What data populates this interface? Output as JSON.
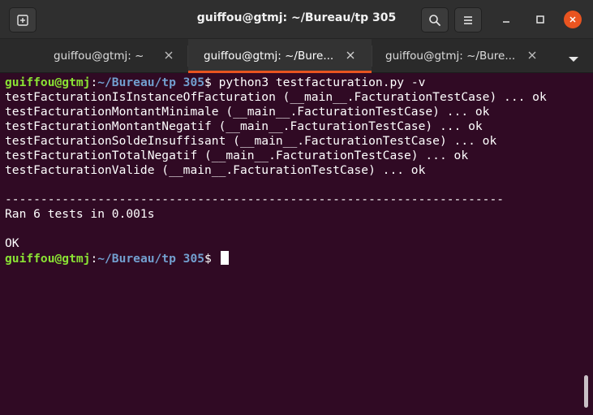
{
  "window": {
    "title": "guiffou@gtmj: ~/Bureau/tp 305"
  },
  "headerbar": {
    "new_tab_icon": "new-tab-icon",
    "search_icon": "search-icon",
    "menu_icon": "hamburger-menu-icon",
    "minimize_icon": "minimize-icon",
    "maximize_icon": "maximize-icon",
    "close_icon": "close-icon"
  },
  "tabs": [
    {
      "label": "guiffou@gtmj: ~",
      "active": false
    },
    {
      "label": "guiffou@gtmj: ~/Bure...",
      "active": true
    },
    {
      "label": "guiffou@gtmj: ~/Bure...",
      "active": false
    }
  ],
  "tab_overflow_icon": "dropdown-arrow-icon",
  "terminal": {
    "prompt_user": "guiffou@gtmj",
    "prompt_sep": ":",
    "prompt_path": "~/Bureau/tp 305",
    "prompt_symbol": "$ ",
    "command": "python3 testfacturation.py -v",
    "output": [
      "testFacturationIsInstanceOfFacturation (__main__.FacturationTestCase) ... ok",
      "testFacturationMontantMinimale (__main__.FacturationTestCase) ... ok",
      "testFacturationMontantNegatif (__main__.FacturationTestCase) ... ok",
      "testFacturationSoldeInsuffisant (__main__.FacturationTestCase) ... ok",
      "testFacturationTotalNegatif (__main__.FacturationTestCase) ... ok",
      "testFacturationValide (__main__.FacturationTestCase) ... ok",
      "",
      "----------------------------------------------------------------------",
      "Ran 6 tests in 0.001s",
      "",
      "OK"
    ]
  },
  "colors": {
    "terminal_bg": "#300a24",
    "prompt_user": "#8ae234",
    "prompt_path": "#729fcf",
    "accent": "#e95420"
  }
}
